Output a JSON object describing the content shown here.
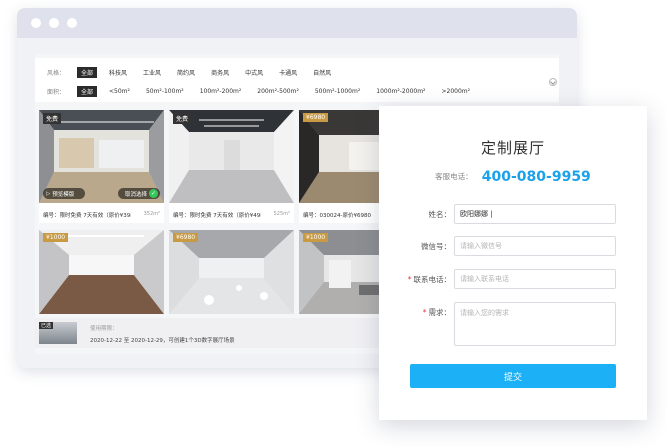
{
  "browser": {
    "window_dots": [
      "dot-1",
      "dot-2",
      "dot-3"
    ]
  },
  "filters": {
    "style_label": "风格：",
    "style_options": [
      "全部",
      "科技风",
      "工业风",
      "简约风",
      "商务风",
      "中式风",
      "卡通风",
      "自然风"
    ],
    "area_label": "面积：",
    "area_options": [
      "全部",
      "<50m²",
      "50m²-100m²",
      "100m²-200m²",
      "200m²-500m²",
      "500m²-1000m²",
      "1000m²-2000m²",
      ">2000m²"
    ],
    "active_style": "全部",
    "active_area": "全部"
  },
  "cards": [
    {
      "badge": "免费",
      "caption": "编号：限时免费 7天有效（原价¥398...",
      "size": "352m²",
      "preview_label": "预览模版",
      "cancel_label": "取消选择"
    },
    {
      "badge": "免费",
      "caption": "编号：限时免费 7天有效（原价¥498...",
      "size": "525m²"
    },
    {
      "badge": "¥6980",
      "caption": "编号：030024-原价¥6980",
      "size": ""
    },
    {
      "badge": "¥1000",
      "caption": "",
      "size": ""
    },
    {
      "badge": "¥6980",
      "caption": "",
      "size": ""
    },
    {
      "badge": "¥1000",
      "caption": "",
      "size": ""
    }
  ],
  "usage": {
    "tag": "已选",
    "label": "使用期限：",
    "text": "2020-12-22 至 2020-12-29，可创建1个3D数字展厅场景"
  },
  "form": {
    "title": "定制展厅",
    "phone_label": "客服电话：",
    "phone": "400-080-9959",
    "name_label": "姓名：",
    "name_value": "欧阳娜娜 |",
    "wechat_label": "微信号：",
    "wechat_placeholder": "请输入微信号",
    "contact_label": "联系电话：",
    "contact_placeholder": "请输入联系电话",
    "needs_label": "需求：",
    "needs_placeholder": "请输入您的需求",
    "required_mark": "*",
    "submit_label": "提交"
  },
  "colors": {
    "accent": "#1cb0f6",
    "phone": "#1aa2ec",
    "required": "#e53935",
    "price_badge": "#c89a43"
  }
}
